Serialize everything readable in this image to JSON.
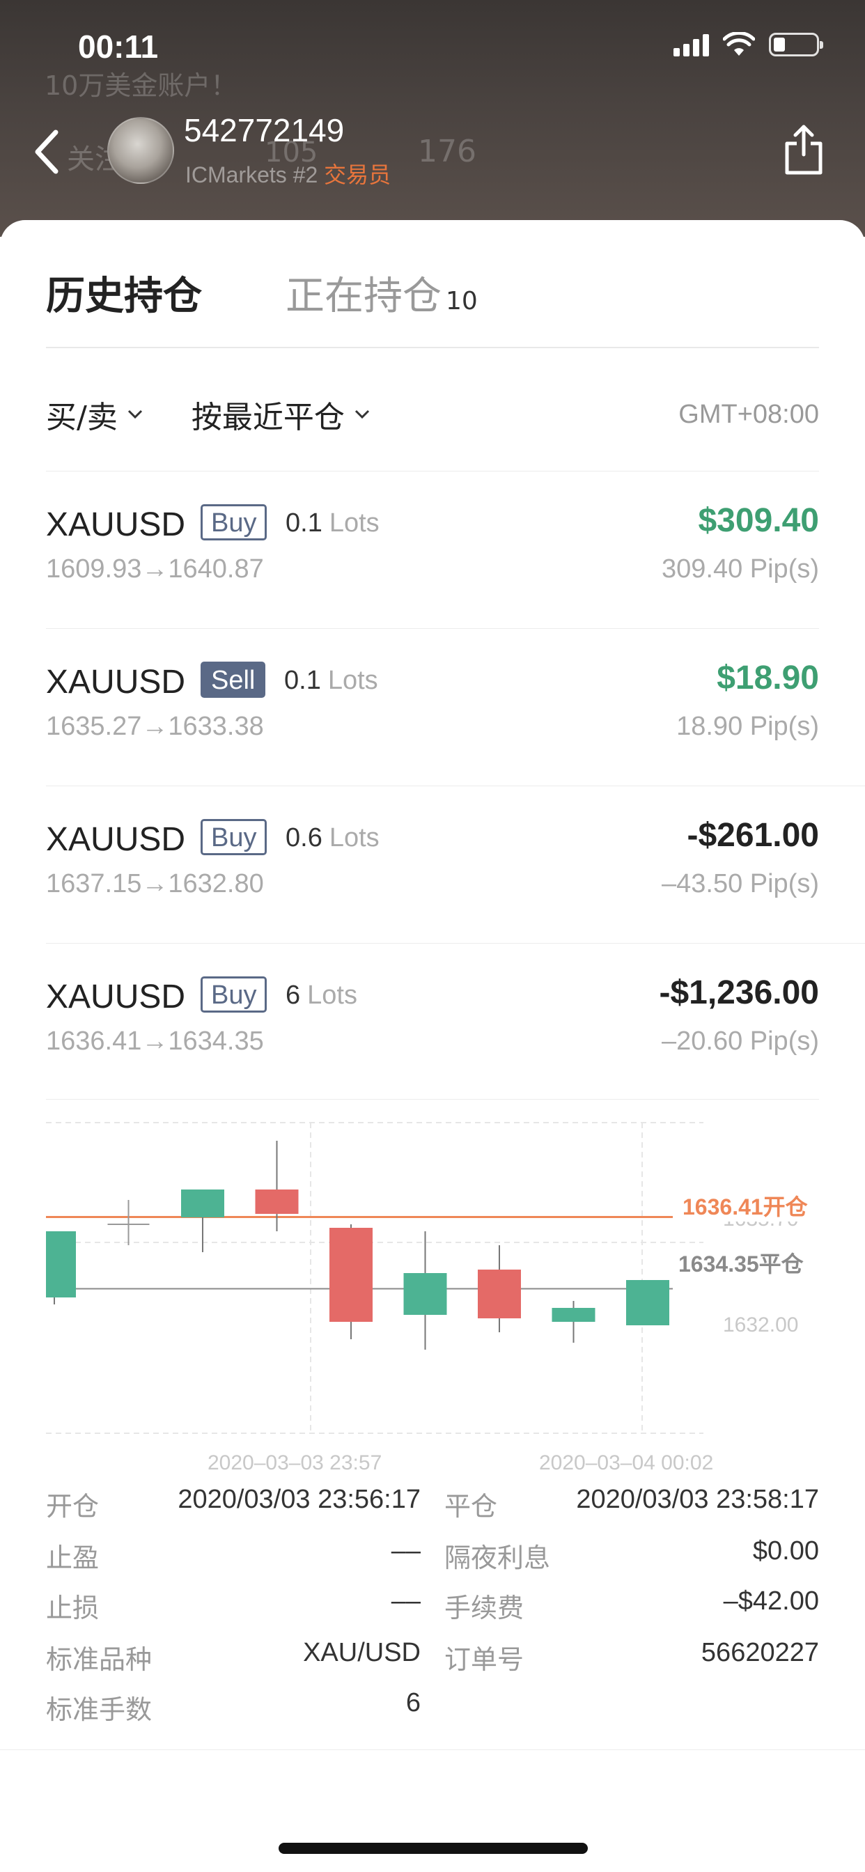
{
  "status_bar": {
    "time": "00:11"
  },
  "header": {
    "user_id": "542772149",
    "broker": "ICMarkets",
    "rank": "#2",
    "role": "交易员",
    "ghost_text_1": "10万美金账户！",
    "ghost_text_2": "关注",
    "ghost_text_3": "105",
    "ghost_text_4": "176"
  },
  "tabs": {
    "history_label": "历史持仓",
    "open_label": "正在持仓",
    "open_count": "10"
  },
  "filters": {
    "side_label": "买/卖",
    "sort_label": "按最近平仓",
    "timezone": "GMT+08:00"
  },
  "trades": [
    {
      "symbol": "XAUUSD",
      "side": "Buy",
      "lots": "0.1",
      "lots_unit": "Lots",
      "prices": "1609.93→1640.87",
      "pnl": "$309.40",
      "pips": "309.40 Pip(s)"
    },
    {
      "symbol": "XAUUSD",
      "side": "Sell",
      "lots": "0.1",
      "lots_unit": "Lots",
      "prices": "1635.27→1633.38",
      "pnl": "$18.90",
      "pips": "18.90 Pip(s)"
    },
    {
      "symbol": "XAUUSD",
      "side": "Buy",
      "lots": "0.6",
      "lots_unit": "Lots",
      "prices": "1637.15→1632.80",
      "pnl": "-$261.00",
      "pips": "–43.50 Pip(s)"
    },
    {
      "symbol": "XAUUSD",
      "side": "Buy",
      "lots": "6",
      "lots_unit": "Lots",
      "prices": "1636.41→1634.35",
      "pnl": "-$1,236.00",
      "pips": "–20.60 Pip(s)"
    }
  ],
  "chart": {
    "open_line_label": "1636.41开仓",
    "close_line_label": "1634.35平仓",
    "tick_y_1": "1635.70",
    "tick_y_2": "1632.00",
    "x_label_1": "2020–03–03 23:57",
    "x_label_2": "2020–03–04 00:02",
    "colors": {
      "up": "#4db393",
      "down": "#e46a67",
      "open_line": "#ef8757",
      "close_line": "#8a8a8a"
    },
    "candles": [
      {
        "o": 1634.1,
        "h": 1636.0,
        "l": 1633.9,
        "c": 1636.0
      },
      {
        "o": 1636.2,
        "h": 1636.9,
        "l": 1635.6,
        "c": 1636.2
      },
      {
        "o": 1636.4,
        "h": 1637.2,
        "l": 1635.4,
        "c": 1637.2
      },
      {
        "o": 1637.2,
        "h": 1638.6,
        "l": 1636.0,
        "c": 1636.5
      },
      {
        "o": 1636.1,
        "h": 1636.2,
        "l": 1632.9,
        "c": 1633.4
      },
      {
        "o": 1633.6,
        "h": 1636.0,
        "l": 1632.6,
        "c": 1634.8
      },
      {
        "o": 1634.9,
        "h": 1635.6,
        "l": 1633.1,
        "c": 1633.5
      },
      {
        "o": 1633.4,
        "h": 1634.0,
        "l": 1632.8,
        "c": 1633.8
      },
      {
        "o": 1633.3,
        "h": 1634.6,
        "l": 1633.3,
        "c": 1634.6
      }
    ],
    "open_price": 1636.41,
    "close_price": 1634.35
  },
  "details": {
    "open_label": "开仓",
    "open_value": "2020/03/03 23:56:17",
    "close_label": "平仓",
    "close_value": "2020/03/03 23:58:17",
    "tp_label": "止盈",
    "tp_value": "––",
    "swap_label": "隔夜利息",
    "swap_value": "$0.00",
    "sl_label": "止损",
    "sl_value": "––",
    "fee_label": "手续费",
    "fee_value": "–$42.00",
    "instrument_label": "标准品种",
    "instrument_value": "XAU/USD",
    "order_label": "订单号",
    "order_value": "56620227",
    "std_lots_label": "标准手数",
    "std_lots_value": "6"
  }
}
